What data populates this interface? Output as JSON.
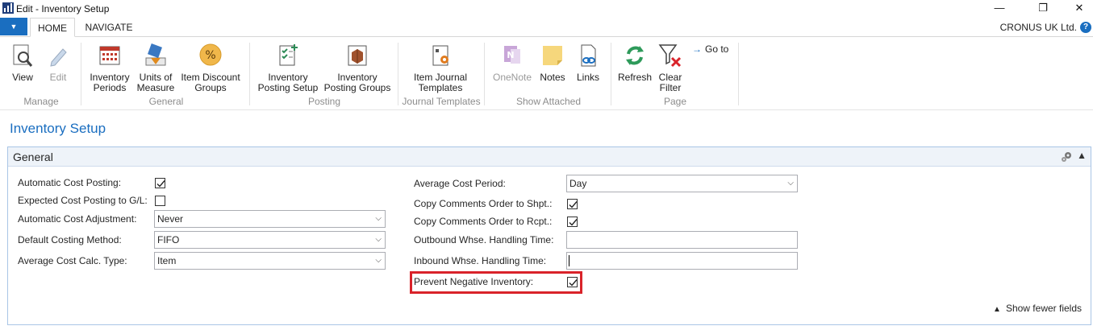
{
  "window": {
    "title": "Edit - Inventory Setup",
    "minimize_glyph": "—",
    "restore_glyph": "❐",
    "close_glyph": "✕"
  },
  "ribbon_tabs": {
    "home": "HOME",
    "navigate": "NAVIGATE",
    "company": "CRONUS UK Ltd.",
    "help": "?"
  },
  "ribbon": {
    "manage": {
      "label": "Manage",
      "view": "View",
      "edit": "Edit"
    },
    "general": {
      "label": "General",
      "inventory_periods": [
        "Inventory",
        "Periods"
      ],
      "units_of_measure": [
        "Units of",
        "Measure"
      ],
      "item_discount_groups": [
        "Item Discount",
        "Groups"
      ]
    },
    "posting": {
      "label": "Posting",
      "inventory_posting_setup": [
        "Inventory",
        "Posting Setup"
      ],
      "inventory_posting_groups": [
        "Inventory",
        "Posting Groups"
      ]
    },
    "journal_templates": {
      "label": "Journal Templates",
      "item_journal_templates": [
        "Item Journal",
        "Templates"
      ]
    },
    "show_attached": {
      "label": "Show Attached",
      "onenote": "OneNote",
      "notes": "Notes",
      "links": "Links"
    },
    "page": {
      "label": "Page",
      "refresh": "Refresh",
      "clear_filter": [
        "Clear",
        "Filter"
      ],
      "go_to": "Go to"
    }
  },
  "page": {
    "title": "Inventory Setup",
    "fasttab_title": "General",
    "show_fewer": "Show fewer fields"
  },
  "fields_left": {
    "automatic_cost_posting": {
      "label": "Automatic Cost Posting:",
      "checked": true
    },
    "expected_cost_posting": {
      "label": "Expected Cost Posting to G/L:",
      "checked": false
    },
    "automatic_cost_adjustment": {
      "label": "Automatic Cost Adjustment:",
      "value": "Never"
    },
    "default_costing_method": {
      "label": "Default Costing Method:",
      "value": "FIFO"
    },
    "average_cost_calc_type": {
      "label": "Average Cost Calc. Type:",
      "value": "Item"
    }
  },
  "fields_right": {
    "average_cost_period": {
      "label": "Average Cost Period:",
      "value": "Day"
    },
    "copy_comments_shpt": {
      "label": "Copy Comments Order to Shpt.:",
      "checked": true
    },
    "copy_comments_rcpt": {
      "label": "Copy Comments Order to Rcpt.:",
      "checked": true
    },
    "outbound_handling_time": {
      "label": "Outbound Whse. Handling Time:",
      "value": ""
    },
    "inbound_handling_time": {
      "label": "Inbound Whse. Handling Time:",
      "value": ""
    },
    "prevent_negative_inventory": {
      "label": "Prevent Negative Inventory:",
      "checked": true
    }
  },
  "colors": {
    "accent": "#1a6ec0",
    "highlight_border": "#d9232a",
    "fasttab_border": "#a9c5e6"
  }
}
